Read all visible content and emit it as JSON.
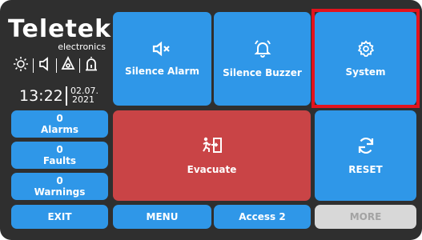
{
  "brand": {
    "name": "Teletek",
    "sub": "electronics"
  },
  "clock": {
    "time": "13:22",
    "date_day_month": "02.07.",
    "date_year": "2021"
  },
  "status_icons": [
    "sun-icon",
    "speaker-icon",
    "alarm-icon",
    "siren-icon"
  ],
  "buttons": {
    "silence_alarm": "Silence Alarm",
    "silence_buzzer": "Silence Buzzer",
    "system": "System",
    "evacuate": "Evacuate",
    "reset": "RESET",
    "exit": "EXIT",
    "menu": "MENU",
    "access": "Access 2",
    "more": "MORE"
  },
  "counters": {
    "alarms": {
      "count": "0",
      "label": "Alarms"
    },
    "faults": {
      "count": "0",
      "label": "Faults"
    },
    "warnings": {
      "count": "0",
      "label": "Warnings"
    }
  },
  "colors": {
    "panel": "#2f2f2f",
    "button": "#2f97e8",
    "evacuate": "#c94446",
    "disabled": "#d8d8d8",
    "highlight": "#e3131d"
  }
}
